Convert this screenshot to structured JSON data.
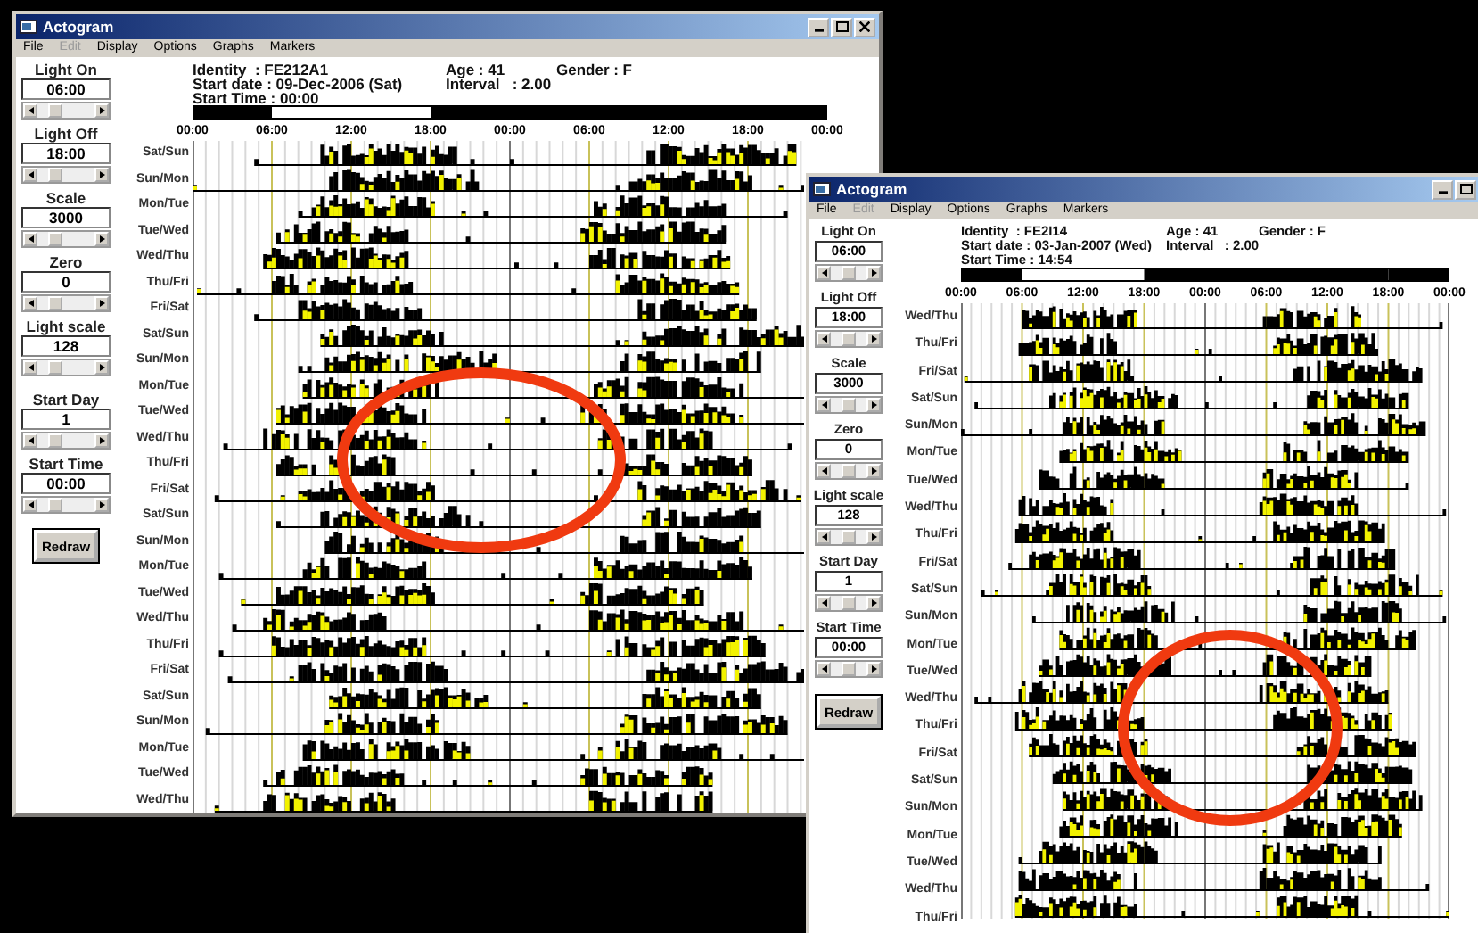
{
  "windows": [
    {
      "title": "Actogram",
      "title_buttons": [
        {
          "kind": "minimize"
        },
        {
          "kind": "maximize"
        },
        {
          "kind": "close"
        }
      ],
      "menu": [
        {
          "label": "File",
          "disabled": false
        },
        {
          "label": "Edit",
          "disabled": true
        },
        {
          "label": "Display",
          "disabled": false
        },
        {
          "label": "Options",
          "disabled": false
        },
        {
          "label": "Graphs",
          "disabled": false
        },
        {
          "label": "Markers",
          "disabled": false
        }
      ],
      "controls": [
        {
          "label": "Light On",
          "value": "06:00"
        },
        {
          "label": "Light Off",
          "value": "18:00"
        },
        {
          "label": "Scale",
          "value": "3000"
        },
        {
          "label": "Zero",
          "value": "0"
        },
        {
          "label": "Light scale",
          "value": "128"
        },
        {
          "label": "Start Day",
          "value": "1"
        },
        {
          "label": "Start Time",
          "value": "00:00"
        }
      ],
      "redraw_button": "Redraw",
      "info_left": [
        "Identity  : FE212A1",
        "Start date : 09-Dec-2006 (Sat)",
        "Start Time : 00:00"
      ],
      "info_mid": [
        "Age : 41",
        "Interval   : 2.00"
      ],
      "info_right": [
        "Gender : F"
      ],
      "time_axis": [
        "00:00",
        "06:00",
        "12:00",
        "18:00",
        "00:00",
        "06:00",
        "12:00",
        "18:00",
        "00:00"
      ],
      "day_labels": [
        "Sat/Sun",
        "Sun/Mon",
        "Mon/Tue",
        "Tue/Wed",
        "Wed/Thu",
        "Thu/Fri",
        "Fri/Sat",
        "Sat/Sun",
        "Sun/Mon",
        "Mon/Tue",
        "Tue/Wed",
        "Wed/Thu",
        "Thu/Fri",
        "Fri/Sat",
        "Sat/Sun",
        "Sun/Mon",
        "Mon/Tue",
        "Tue/Wed",
        "Wed/Thu",
        "Thu/Fri",
        "Fri/Sat",
        "Sat/Sun",
        "Sun/Mon",
        "Mon/Tue",
        "Tue/Wed",
        "Wed/Thu"
      ]
    },
    {
      "title": "Actogram",
      "title_buttons": [
        {
          "kind": "minimize"
        },
        {
          "kind": "maximize"
        }
      ],
      "menu": [
        {
          "label": "File",
          "disabled": false
        },
        {
          "label": "Edit",
          "disabled": true
        },
        {
          "label": "Display",
          "disabled": false
        },
        {
          "label": "Options",
          "disabled": false
        },
        {
          "label": "Graphs",
          "disabled": false
        },
        {
          "label": "Markers",
          "disabled": false
        }
      ],
      "controls": [
        {
          "label": "Light On",
          "value": "06:00"
        },
        {
          "label": "Light Off",
          "value": "18:00"
        },
        {
          "label": "Scale",
          "value": "3000"
        },
        {
          "label": "Zero",
          "value": "0"
        },
        {
          "label": "Light scale",
          "value": "128"
        },
        {
          "label": "Start Day",
          "value": "1"
        },
        {
          "label": "Start Time",
          "value": "00:00"
        }
      ],
      "redraw_button": "Redraw",
      "info_left": [
        "Identity  : FE2I14",
        "Start date : 03-Jan-2007 (Wed)",
        "Start Time : 14:54"
      ],
      "info_mid": [
        "Age : 41",
        "Interval   : 2.00"
      ],
      "info_right": [
        "Gender : F"
      ],
      "time_axis": [
        "00:00",
        "06:00",
        "12:00",
        "18:00",
        "00:00",
        "06:00",
        "12:00",
        "18:00",
        "00:00"
      ],
      "day_labels": [
        "Wed/Thu",
        "Thu/Fri",
        "Fri/Sat",
        "Sat/Sun",
        "Sun/Mon",
        "Mon/Tue",
        "Tue/Wed",
        "Wed/Thu",
        "Thu/Fri",
        "Fri/Sat",
        "Sat/Sun",
        "Sun/Mon",
        "Mon/Tue",
        "Tue/Wed",
        "Wed/Thu",
        "Thu/Fri",
        "Fri/Sat",
        "Sat/Sun",
        "Sun/Mon",
        "Mon/Tue",
        "Tue/Wed",
        "Wed/Thu",
        "Thu/Fri"
      ]
    }
  ]
}
